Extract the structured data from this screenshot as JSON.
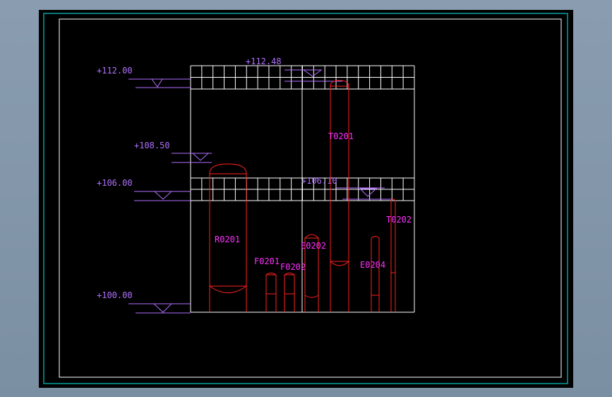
{
  "drawing": {
    "colors": {
      "background": "#000000",
      "border_outer": "#00c8c8",
      "border_inner": "#ffffff",
      "structure": "#ffffff",
      "equipment": "#ff2020",
      "equipment_label": "#ff30ff",
      "elevation": "#b070ff"
    },
    "elevations": [
      {
        "text": "+112.00"
      },
      {
        "text": "+112.48"
      },
      {
        "text": "+108.50"
      },
      {
        "text": "+106.00"
      },
      {
        "text": "+106.10"
      },
      {
        "text": "+100.00"
      }
    ],
    "equipment": [
      {
        "tag": "R0201"
      },
      {
        "tag": "F0201"
      },
      {
        "tag": "F0202"
      },
      {
        "tag": "E0202"
      },
      {
        "tag": "T0201"
      },
      {
        "tag": "E0204"
      },
      {
        "tag": "T0202"
      }
    ]
  }
}
